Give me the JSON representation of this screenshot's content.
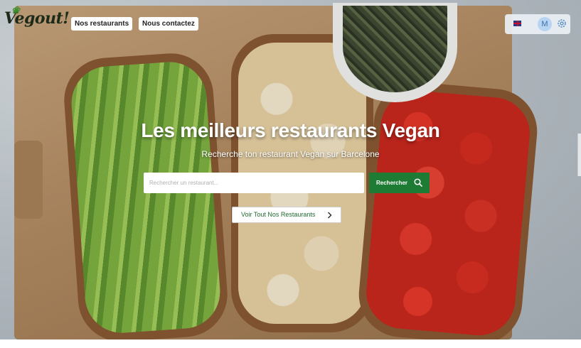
{
  "brand": {
    "logo_text": "Vegout!",
    "logo_icon": "leaf-icon"
  },
  "nav": {
    "restaurants_label": "Nos restaurants",
    "contact_label": "Nous contactez"
  },
  "toolbar": {
    "language_icon": "uk-flag-icon",
    "avatar_initial": "M",
    "settings_icon": "gear-icon"
  },
  "hero": {
    "title": "Les meilleurs restaurants Vegan",
    "subtitle": "Recherche ton restaurant Vegan sur Barcelone",
    "search_placeholder": "Rechercher un restaurant...",
    "search_value": "",
    "search_button_label": "Rechercher",
    "search_button_icon": "search-icon",
    "all_button_label": "Voir Tout Nos Restaurants",
    "all_button_icon": "chevron-right-icon"
  },
  "colors": {
    "accent_green": "#1e7b34",
    "text_white": "#ffffff",
    "avatar_bg": "#b8d4f3"
  }
}
